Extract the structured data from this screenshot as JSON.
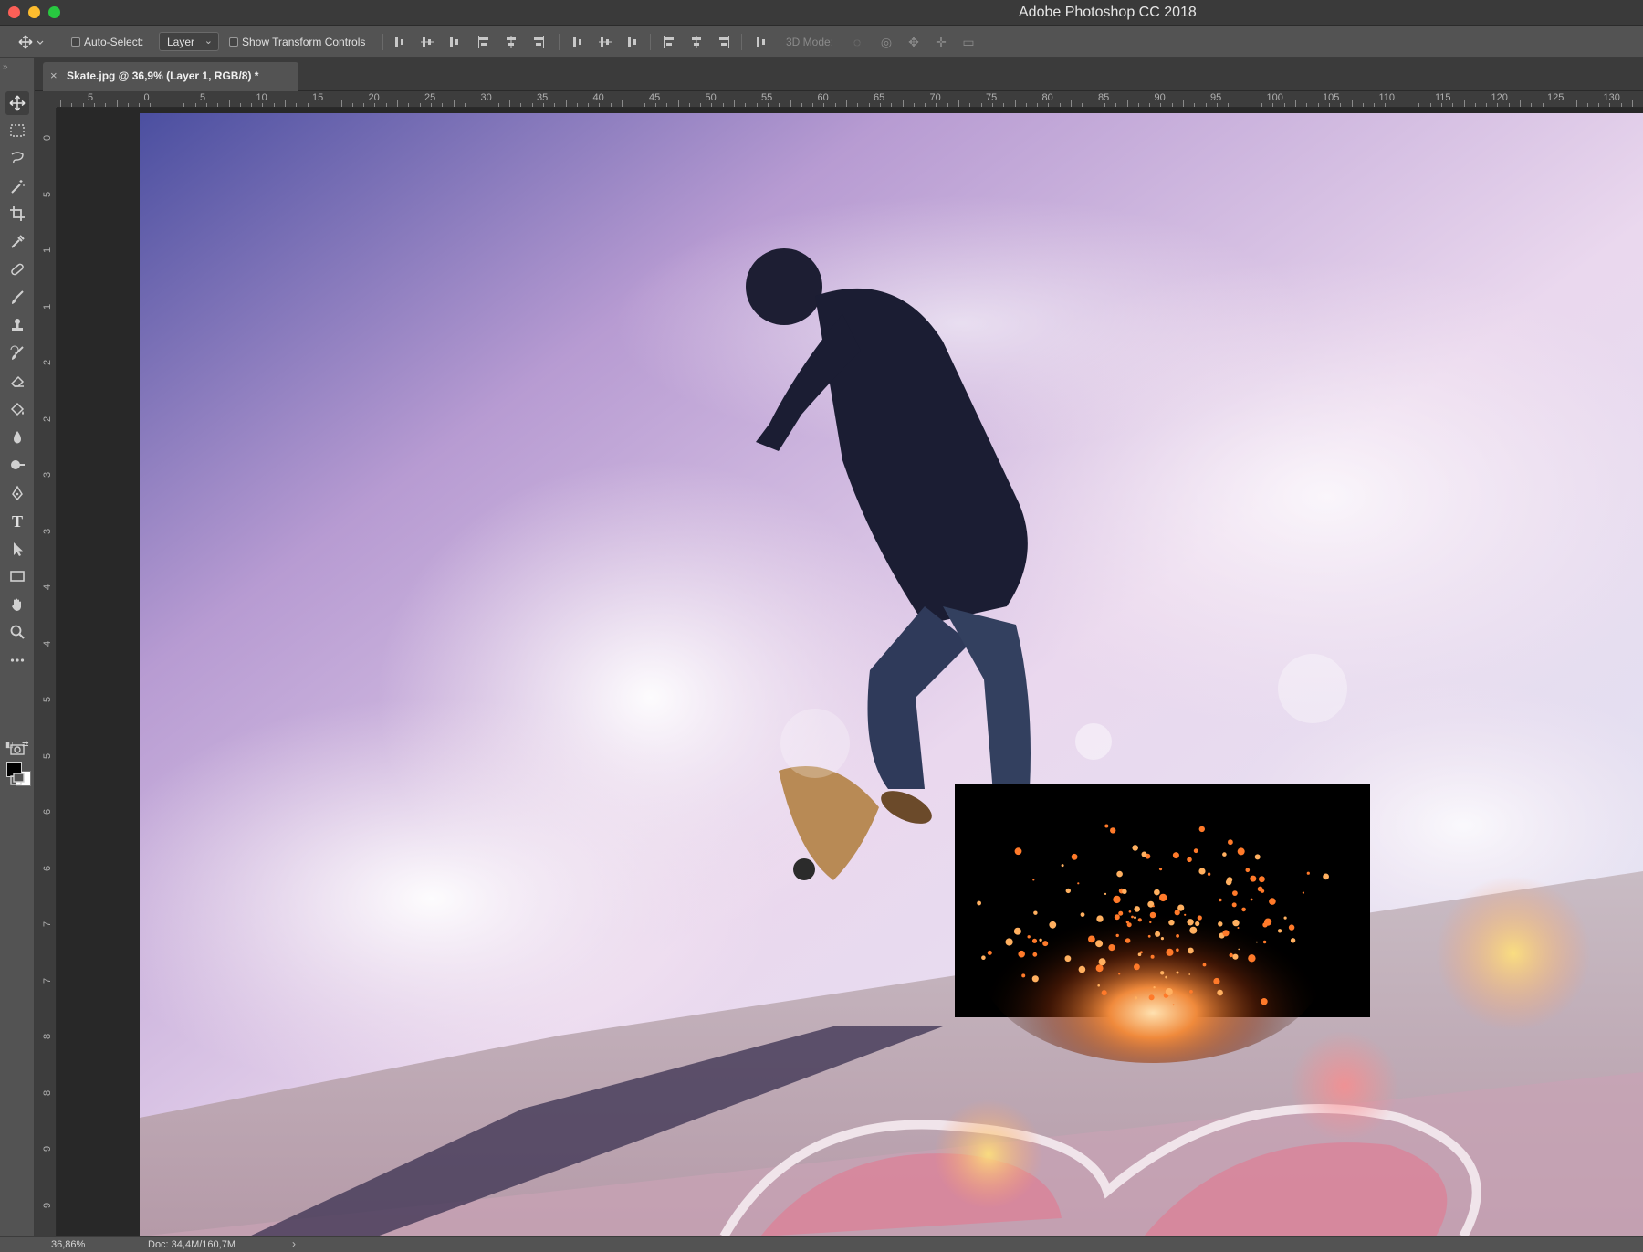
{
  "window": {
    "title": "Adobe Photoshop CC 2018"
  },
  "options_bar": {
    "auto_select_label": "Auto-Select:",
    "auto_select_target": "Layer",
    "show_transform_label": "Show Transform Controls",
    "mode_3d_label": "3D Mode:"
  },
  "document_tab": {
    "close_glyph": "×",
    "label": "Skate.jpg @ 36,9% (Layer 1, RGB/8) *"
  },
  "rulers": {
    "top_labels": [
      "5",
      "0",
      "5",
      "10",
      "15",
      "20",
      "25",
      "30",
      "35",
      "40",
      "45",
      "50",
      "55",
      "60",
      "65",
      "70",
      "75",
      "80",
      "85",
      "90",
      "95",
      "100",
      "105",
      "110",
      "115",
      "120",
      "125",
      "130"
    ],
    "left_labels": [
      "0",
      "5",
      "1",
      "1",
      "2",
      "2",
      "3",
      "3",
      "4",
      "4",
      "5",
      "5",
      "6",
      "6",
      "7",
      "7",
      "8",
      "8",
      "9",
      "9"
    ]
  },
  "toolbar": {
    "tools": [
      {
        "name": "move-tool",
        "icon": "move-icon",
        "active": true
      },
      {
        "name": "marquee-tool",
        "icon": "rectangle-marquee-icon"
      },
      {
        "name": "lasso-tool",
        "icon": "lasso-icon"
      },
      {
        "name": "magic-wand-tool",
        "icon": "magic-wand-icon"
      },
      {
        "name": "crop-tool",
        "icon": "crop-icon"
      },
      {
        "name": "eyedropper-tool",
        "icon": "eyedropper-icon"
      },
      {
        "name": "healing-brush-tool",
        "icon": "bandage-icon"
      },
      {
        "name": "brush-tool",
        "icon": "brush-icon"
      },
      {
        "name": "clone-stamp-tool",
        "icon": "stamp-icon"
      },
      {
        "name": "history-brush-tool",
        "icon": "history-brush-icon"
      },
      {
        "name": "eraser-tool",
        "icon": "eraser-icon"
      },
      {
        "name": "paint-bucket-tool",
        "icon": "paint-bucket-icon"
      },
      {
        "name": "blur-tool",
        "icon": "drop-icon"
      },
      {
        "name": "dodge-tool",
        "icon": "dodge-icon"
      },
      {
        "name": "pen-tool",
        "icon": "pen-icon"
      },
      {
        "name": "type-tool",
        "icon": "type-icon"
      },
      {
        "name": "path-selection-tool",
        "icon": "arrow-icon"
      },
      {
        "name": "rectangle-tool",
        "icon": "rectangle-icon"
      },
      {
        "name": "hand-tool",
        "icon": "hand-icon"
      },
      {
        "name": "zoom-tool",
        "icon": "magnifier-icon"
      },
      {
        "name": "edit-toolbar",
        "icon": "more-icon"
      }
    ],
    "type_glyph": "T",
    "more_glyph": "•••",
    "foreground_color": "#000000",
    "background_color": "#ffffff"
  },
  "status_bar": {
    "zoom": "36,86%",
    "doc_size": "Doc: 34,4M/160,7M",
    "arrow": "›"
  },
  "colors": {
    "panel": "#535353",
    "pasteboard": "#282828",
    "title_bar": "#3a3a3a"
  }
}
